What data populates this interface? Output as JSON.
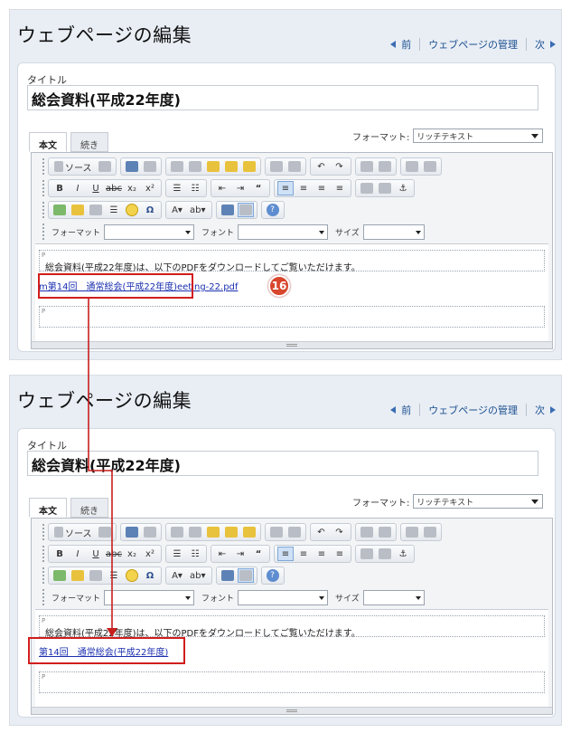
{
  "screens": [
    {
      "header": {
        "title": "ウェブページの編集",
        "nav_prev": "前",
        "nav_manage": "ウェブページの管理",
        "nav_next": "次"
      },
      "form": {
        "title_label": "タイトル",
        "title_value": "総会資料(平成22年度)"
      },
      "tabs": [
        "本文",
        "続き"
      ],
      "format": {
        "label": "フォーマット:",
        "value": "リッチテキスト"
      },
      "toolbar": {
        "source_label": "ソース",
        "format_combo_label": "フォーマット",
        "font_combo_label": "フォント",
        "size_combo_label": "サイズ"
      },
      "content": {
        "para_mark": "P",
        "para1_text": "総会資料(平成22年度)は、以下のPDFをダウンロードしてご覧いただけます。",
        "link_text": "m第14回　通常総会(平成22年度)eeting-22.pdf"
      },
      "badge": "16"
    },
    {
      "header": {
        "title": "ウェブページの編集",
        "nav_prev": "前",
        "nav_manage": "ウェブページの管理",
        "nav_next": "次"
      },
      "form": {
        "title_label": "タイトル",
        "title_value": "総会資料(平成22年度)"
      },
      "tabs": [
        "本文",
        "続き"
      ],
      "format": {
        "label": "フォーマット:",
        "value": "リッチテキスト"
      },
      "toolbar": {
        "source_label": "ソース",
        "format_combo_label": "フォーマット",
        "font_combo_label": "フォント",
        "size_combo_label": "サイズ"
      },
      "content": {
        "para_mark": "P",
        "para1_text": "総会資料(平成22年度)は、以下のPDFをダウンロードしてご覧いただけます。",
        "link_text": "第14回　通常総会(平成22年度)"
      }
    }
  ],
  "colors": {
    "highlight": "#d21d1d",
    "badge": "#d8462b",
    "link": "#1a2fb0",
    "panel_bg": "#e9eef5"
  }
}
